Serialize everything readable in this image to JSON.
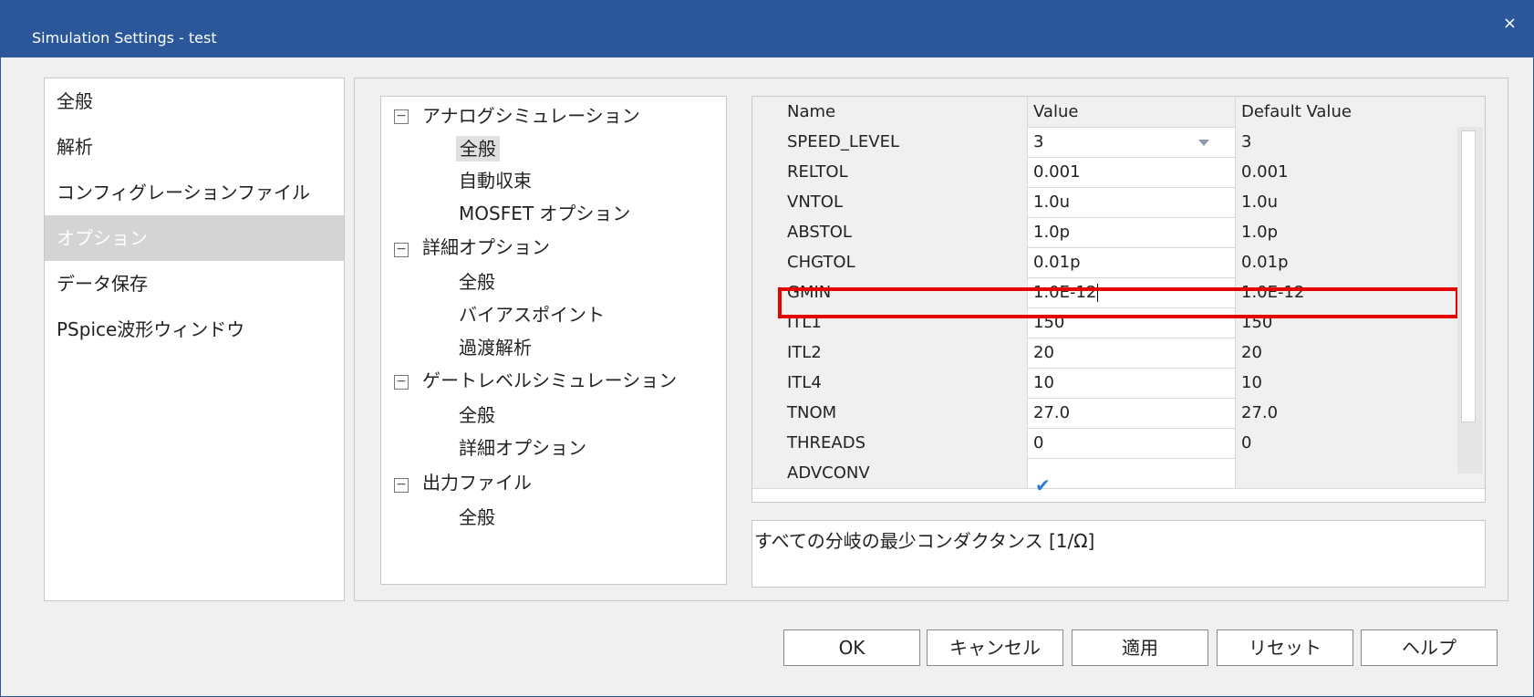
{
  "window": {
    "title": "Simulation Settings - test",
    "close_glyph": "×"
  },
  "sidebar": {
    "items": [
      {
        "label": "全般"
      },
      {
        "label": "解析"
      },
      {
        "label": "コンフィグレーションファイル"
      },
      {
        "label": "オプション",
        "selected": true
      },
      {
        "label": "データ保存"
      },
      {
        "label": "PSpice波形ウィンドウ"
      }
    ]
  },
  "tree": {
    "nodes": [
      {
        "label": "アナログシミュレーション",
        "level": 0,
        "toggle": "−"
      },
      {
        "label": "全般",
        "level": 1,
        "selected": true
      },
      {
        "label": "自動収束",
        "level": 1
      },
      {
        "label": "MOSFET オプション",
        "level": 1
      },
      {
        "label": "詳細オプション",
        "level": 0,
        "toggle": "−"
      },
      {
        "label": "全般",
        "level": 1
      },
      {
        "label": "バイアスポイント",
        "level": 1
      },
      {
        "label": "過渡解析",
        "level": 1
      },
      {
        "label": "ゲートレベルシミュレーション",
        "level": 0,
        "toggle": "−"
      },
      {
        "label": "全般",
        "level": 1
      },
      {
        "label": "詳細オプション",
        "level": 1
      },
      {
        "label": "出力ファイル",
        "level": 0,
        "toggle": "−"
      },
      {
        "label": "全般",
        "level": 1
      }
    ]
  },
  "grid": {
    "headers": {
      "name": "Name",
      "value": "Value",
      "default": "Default Value"
    },
    "rows": [
      {
        "name": "SPEED_LEVEL",
        "value": "3",
        "default": "3"
      },
      {
        "name": "RELTOL",
        "value": "0.001",
        "default": "0.001"
      },
      {
        "name": "VNTOL",
        "value": "1.0u",
        "default": "1.0u"
      },
      {
        "name": "ABSTOL",
        "value": "1.0p",
        "default": "1.0p"
      },
      {
        "name": "CHGTOL",
        "value": "0.01p",
        "default": "0.01p"
      },
      {
        "name": "GMIN",
        "value": "1.0E-12",
        "default": "1.0E-12"
      },
      {
        "name": "ITL1",
        "value": "150",
        "default": "150"
      },
      {
        "name": "ITL2",
        "value": "20",
        "default": "20"
      },
      {
        "name": "ITL4",
        "value": "10",
        "default": "10"
      },
      {
        "name": "TNOM",
        "value": "27.0",
        "default": "27.0"
      },
      {
        "name": "THREADS",
        "value": "0",
        "default": "0"
      },
      {
        "name": "ADVCONV",
        "value": "",
        "default": "",
        "checked": true
      }
    ]
  },
  "description": "すべての分岐の最少コンダクタンス [1/Ω]",
  "buttons": {
    "ok": "OK",
    "cancel": "キャンセル",
    "apply": "適用",
    "reset": "リセット",
    "help": "ヘルプ"
  },
  "colors": {
    "titlebar": "#2b579a",
    "highlight": "#e60000",
    "check": "#2b7ad9"
  }
}
